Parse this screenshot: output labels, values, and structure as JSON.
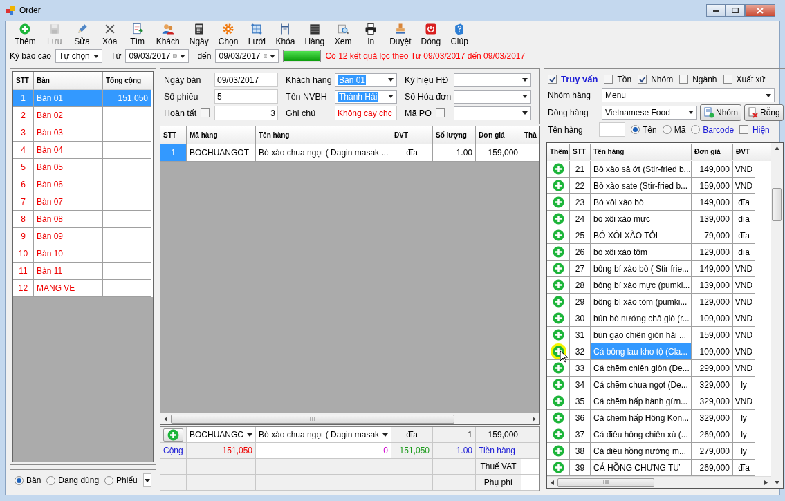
{
  "window": {
    "title": "Order"
  },
  "toolbar": [
    {
      "label": "Thêm",
      "disabled": false
    },
    {
      "label": "Lưu",
      "disabled": true
    },
    {
      "label": "Sửa",
      "disabled": false
    },
    {
      "label": "Xóa",
      "disabled": false
    },
    {
      "label": "Tìm",
      "disabled": false
    },
    {
      "label": "Khách",
      "disabled": false
    },
    {
      "label": "Ngày",
      "disabled": false
    },
    {
      "label": "Chọn",
      "disabled": false
    },
    {
      "label": "Lưới",
      "disabled": false
    },
    {
      "label": "Khóa",
      "disabled": false
    },
    {
      "label": "Hàng",
      "disabled": false
    },
    {
      "label": "Xem",
      "disabled": false
    },
    {
      "label": "In",
      "disabled": false
    },
    {
      "label": "Duyệt",
      "disabled": false
    },
    {
      "label": "Đóng",
      "disabled": false
    },
    {
      "label": "Giúp",
      "disabled": false
    }
  ],
  "filter": {
    "period_label": "Kỳ báo cáo",
    "period": "Tự chọn",
    "from_label": "Từ",
    "from": "09/03/2017",
    "to_label": "đến",
    "to": "09/03/2017",
    "progress": {
      "level": 1
    },
    "message": "Có 12 kết quả lọc theo Từ 09/03/2017 đến 09/03/2017"
  },
  "tables": {
    "columns": [
      "STT",
      "Bàn",
      "Tổng cộng"
    ],
    "rows": [
      {
        "stt": "1",
        "name": "Bàn 01",
        "total": "151,050",
        "selected": true
      },
      {
        "stt": "2",
        "name": "Bàn 02",
        "selected": false
      },
      {
        "stt": "3",
        "name": "Bàn 03",
        "selected": false
      },
      {
        "stt": "4",
        "name": "Bàn 04",
        "selected": false
      },
      {
        "stt": "5",
        "name": "Bàn 05",
        "selected": false
      },
      {
        "stt": "6",
        "name": "Bàn 06",
        "selected": false
      },
      {
        "stt": "7",
        "name": "Bàn 07",
        "selected": false
      },
      {
        "stt": "8",
        "name": "Bàn 08",
        "selected": false
      },
      {
        "stt": "9",
        "name": "Bàn 09",
        "selected": false
      },
      {
        "stt": "10",
        "name": "Bàn 10",
        "selected": false
      },
      {
        "stt": "11",
        "name": "Bàn 11",
        "selected": false
      },
      {
        "stt": "12",
        "name": "MANG VE",
        "selected": false
      }
    ],
    "views": [
      {
        "label": "Bàn",
        "selected": true
      },
      {
        "label": "Đang dùng",
        "selected": false
      },
      {
        "label": "Phiếu",
        "selected": false
      }
    ]
  },
  "form": {
    "sale_date_label": "Ngày bán",
    "sale_date": "09/03/2017",
    "number_label": "Số phiếu",
    "number": "5",
    "done_label": "Hoàn tất",
    "done": false,
    "done_value": "3",
    "customer_label": "Khách hàng",
    "customer": "Bàn 01",
    "staff_label": "Tên NVBH",
    "staff": "Thành Hải",
    "note_label": "Ghi chú",
    "note": "Không cay chc",
    "invoice_symbol_label": "Ký hiệu HĐ",
    "invoice_number_label": "Số Hóa đơn",
    "po_label": "Mã PO",
    "po": false
  },
  "order": {
    "columns": [
      "STT",
      "Mã hàng",
      "Tên hàng",
      "ĐVT",
      "Số lượng",
      "Đơn giá",
      "Thà"
    ],
    "rows": [
      {
        "stt": "1",
        "code": "BOCHUANGOT",
        "name": "Bò xào chua ngọt ( Dagin masak ...",
        "unit": "đĩa",
        "qty": "1.00",
        "price": "159,000"
      }
    ],
    "entry": {
      "code": "BOCHUANGC",
      "name": "Bò xào chua ngọt ( Dagin masak",
      "unit": "đĩa",
      "qty": "1",
      "price": "159,000"
    },
    "totals": {
      "label": "Cộng",
      "amount": "151,050",
      "discount": "0",
      "net": "151,050",
      "qty": "1.00",
      "goods_label": "Tiền hàng"
    },
    "vat_label": "Thuế VAT",
    "fee_label": "Phụ phí"
  },
  "search": {
    "filters": [
      {
        "label": "Truy vấn",
        "checked": true
      },
      {
        "label": "Tồn",
        "checked": false
      },
      {
        "label": "Nhóm",
        "checked": true
      },
      {
        "label": "Ngành",
        "checked": false
      },
      {
        "label": "Xuất xứ",
        "checked": false
      }
    ],
    "group_label": "Nhóm hàng",
    "group": "Menu",
    "line_label": "Dòng hàng",
    "line": "Vietnamese Food",
    "group_button": "Nhóm",
    "clear_button": "Rỗng",
    "name_label": "Tên hàng",
    "modes": [
      {
        "label": "Tên",
        "selected": true
      },
      {
        "label": "Mã",
        "selected": false
      },
      {
        "label": "Barcode",
        "selected": false
      }
    ],
    "show_label": "Hiện",
    "show": false
  },
  "products": {
    "columns": [
      "Thêm",
      "STT",
      "Tên hàng",
      "Đơn giá",
      "ĐVT"
    ],
    "rows": [
      {
        "stt": "21",
        "name": "Bò xào sả ớt (Stir-fried b...",
        "price": "149,000",
        "unit": "VND",
        "selected": false
      },
      {
        "stt": "22",
        "name": "Bò xào sate (Stir-fried b...",
        "price": "159,000",
        "unit": "VND",
        "selected": false
      },
      {
        "stt": "23",
        "name": "Bó xôi xào bò",
        "price": "149,000",
        "unit": "đĩa",
        "selected": false
      },
      {
        "stt": "24",
        "name": "bó xôi xào mực",
        "price": "139,000",
        "unit": "đĩa",
        "selected": false
      },
      {
        "stt": "25",
        "name": "BÓ XÔI XÀO TỎI",
        "price": "79,000",
        "unit": "đĩa",
        "selected": false
      },
      {
        "stt": "26",
        "name": "bó xôi xào tôm",
        "price": "129,000",
        "unit": "đĩa",
        "selected": false
      },
      {
        "stt": "27",
        "name": "bông bí xào bò ( Stir frie...",
        "price": "149,000",
        "unit": "VND",
        "selected": false
      },
      {
        "stt": "28",
        "name": "bông bí xào mực (pumki...",
        "price": "139,000",
        "unit": "VND",
        "selected": false
      },
      {
        "stt": "29",
        "name": "bông bí xào tôm (pumki...",
        "price": "129,000",
        "unit": "VND",
        "selected": false
      },
      {
        "stt": "30",
        "name": "bún bò nướng chả giò (r...",
        "price": "109,000",
        "unit": "VND",
        "selected": false
      },
      {
        "stt": "31",
        "name": "bún gạo chiên giòn hải ...",
        "price": "159,000",
        "unit": "VND",
        "selected": false
      },
      {
        "stt": "32",
        "name": "Cá bông lau kho tộ (Cla...",
        "price": "109,000",
        "unit": "VND",
        "selected": true
      },
      {
        "stt": "33",
        "name": "Cá chẽm chiên giòn (De...",
        "price": "299,000",
        "unit": "VND",
        "selected": false
      },
      {
        "stt": "34",
        "name": "Cá chẽm chua ngọt (De...",
        "price": "329,000",
        "unit": "ly",
        "selected": false
      },
      {
        "stt": "35",
        "name": "Cá chẽm hấp hành gừn...",
        "price": "329,000",
        "unit": "VND",
        "selected": false
      },
      {
        "stt": "36",
        "name": "Cá chẽm hấp Hông Kon...",
        "price": "329,000",
        "unit": "ly",
        "selected": false
      },
      {
        "stt": "37",
        "name": "Cá điêu hồng chiên xù (...",
        "price": "269,000",
        "unit": "ly",
        "selected": false
      },
      {
        "stt": "38",
        "name": "Cá điêu hồng nướng m...",
        "price": "279,000",
        "unit": "ly",
        "selected": false
      },
      {
        "stt": "39",
        "name": "CÁ HỒNG CHƯNG TƯ",
        "price": "269,000",
        "unit": "đĩa",
        "selected": false
      }
    ]
  }
}
